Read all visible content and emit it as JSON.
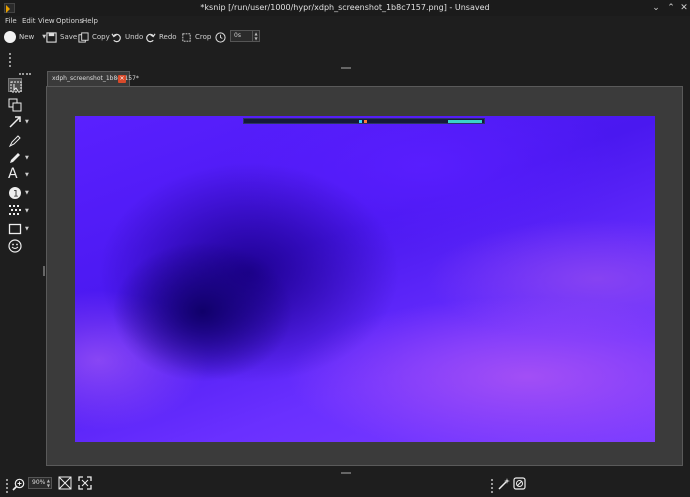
{
  "window": {
    "title": "*ksnip [/run/user/1000/hypr/xdph_screenshot_1b8c7157.png] - Unsaved"
  },
  "menu": [
    {
      "label": "File"
    },
    {
      "label": "Edit"
    },
    {
      "label": "View"
    },
    {
      "label": "Options"
    },
    {
      "label": "Help"
    }
  ],
  "toolbar": {
    "new_label": "New",
    "save_label": "Save",
    "copy_label": "Copy",
    "undo_label": "Undo",
    "redo_label": "Redo",
    "crop_label": "Crop",
    "delay_value": "0s"
  },
  "tabs": [
    {
      "label": "xdph_screenshot_1b8c7157*"
    }
  ],
  "tools": [
    {
      "icon": "select-icon"
    },
    {
      "icon": "duplicate-icon"
    },
    {
      "icon": "arrow-icon"
    },
    {
      "icon": "pen-icon"
    },
    {
      "icon": "marker-icon"
    },
    {
      "icon": "text-icon"
    },
    {
      "icon": "number-icon"
    },
    {
      "icon": "blur-icon"
    },
    {
      "icon": "rectangle-icon"
    },
    {
      "icon": "sticker-icon"
    }
  ],
  "status": {
    "zoom_value": "90%"
  },
  "colors": {
    "accent": "#e8a000",
    "tab_close": "#d84a2a",
    "background": "#1e1e1e",
    "editor": "#3b3b3b"
  }
}
